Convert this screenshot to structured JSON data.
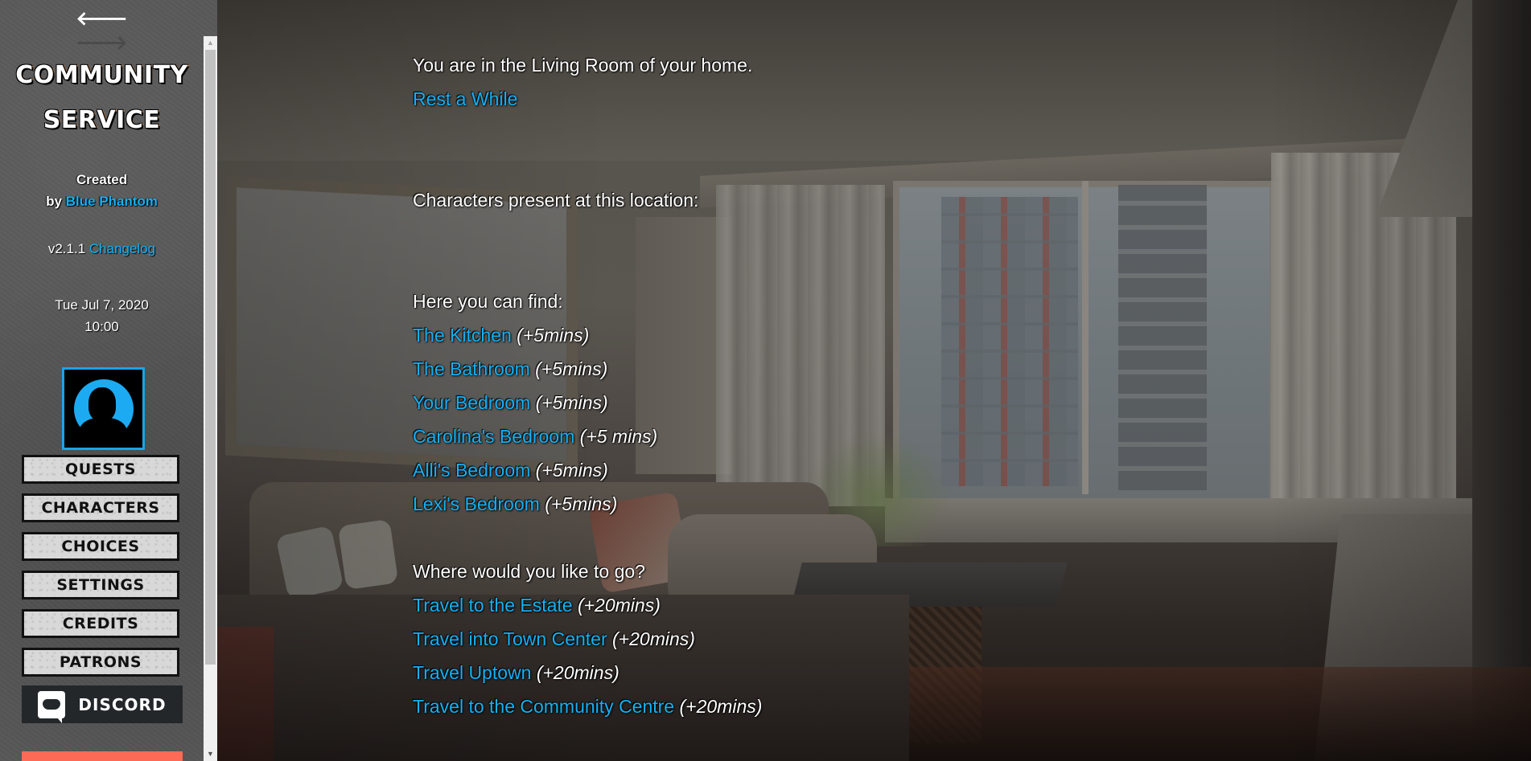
{
  "sidebar": {
    "nav": {
      "back_icon": "🡐",
      "forward_icon": "🡒"
    },
    "title_line1": "COMMUNITY",
    "title_line2": "SERVICE",
    "created_label": "Created",
    "by_label": "by",
    "author": "Blue Phantom",
    "version": "v2.1.1",
    "changelog_label": "Changelog",
    "date": "Tue Jul 7, 2020",
    "time": "10:00",
    "avatar": {
      "icon": "player-portrait-icon",
      "border_color": "#1aa3e8"
    },
    "menu": [
      {
        "label": "QUESTS"
      },
      {
        "label": "CHARACTERS"
      },
      {
        "label": "CHOICES"
      },
      {
        "label": "SETTINGS"
      },
      {
        "label": "CREDITS"
      },
      {
        "label": "PATRONS"
      }
    ],
    "discord_label": "DISCORD",
    "scrollbar": {
      "up_icon": "▲",
      "down_icon": "▼"
    }
  },
  "passage": {
    "location_text": "You are in the Living Room of your home.",
    "rest_link": "Rest a While",
    "characters_heading": "Characters present at this location:",
    "find_heading": "Here you can find:",
    "rooms": [
      {
        "label": "The Kitchen",
        "cost": "(+5mins)"
      },
      {
        "label": "The Bathroom",
        "cost": "(+5mins)"
      },
      {
        "label": "Your Bedroom",
        "cost": "(+5mins)"
      },
      {
        "label": "Carolina's Bedroom",
        "cost": "(+5 mins)"
      },
      {
        "label": "Alli's Bedroom",
        "cost": "(+5mins)"
      },
      {
        "label": "Lexi's Bedroom",
        "cost": "(+5mins)"
      }
    ],
    "travel_heading": "Where would you like to go?",
    "destinations": [
      {
        "label": "Travel to the Estate",
        "cost": "(+20mins)"
      },
      {
        "label": "Travel into Town Center",
        "cost": "(+20mins)"
      },
      {
        "label": "Travel Uptown",
        "cost": "(+20mins)"
      },
      {
        "label": "Travel to the Community Centre",
        "cost": "(+20mins)"
      }
    ]
  },
  "colors": {
    "link": "#15b1f5",
    "sidebar_bg": "#5a5a5a",
    "menu_button_bg": "#d8d8d8",
    "discord_bg": "#23272a",
    "accent_bar": "#fd6a55"
  }
}
